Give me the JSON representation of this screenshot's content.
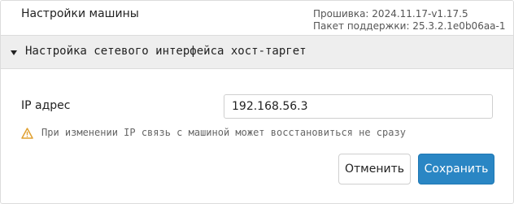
{
  "header": {
    "title": "Настройки машины",
    "firmware": "Прошивка: 2024.11.17-v1.17.5",
    "support_pack": "Пакет поддержки: 25.3.2.1e0b06aa-1"
  },
  "section": {
    "title": "Настройка сетевого интерфейса хост-таргет",
    "expanded": true
  },
  "form": {
    "ip_label": "IP адрес",
    "ip_value": "192.168.56.3",
    "warning_text": "При изменении IP связь с машиной может восстановиться не сразу",
    "warning_icon": "warning-triangle-icon"
  },
  "buttons": {
    "cancel": "Отменить",
    "save": "Сохранить"
  },
  "colors": {
    "accent": "#2a86c4",
    "warning": "#e0a030"
  }
}
